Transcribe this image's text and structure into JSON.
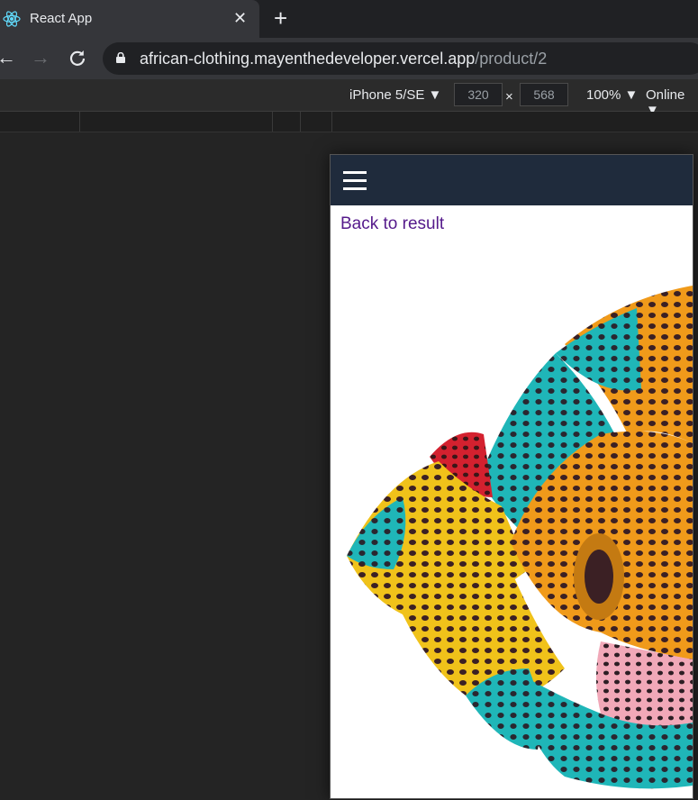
{
  "browser": {
    "tab_title": "React App",
    "tab_close": "✕",
    "new_tab": "+",
    "url_host": "african-clothing.mayenthedeveloper.vercel.app",
    "url_path": "/product/2"
  },
  "devtools": {
    "device": "iPhone 5/SE ▼",
    "width": "320",
    "height": "568",
    "times": "×",
    "zoom": "100% ▼",
    "network": "Online ▼"
  },
  "page": {
    "back_link": "Back to result"
  },
  "colors": {
    "navbar": "#1f2b3c",
    "link": "#551a8b"
  }
}
